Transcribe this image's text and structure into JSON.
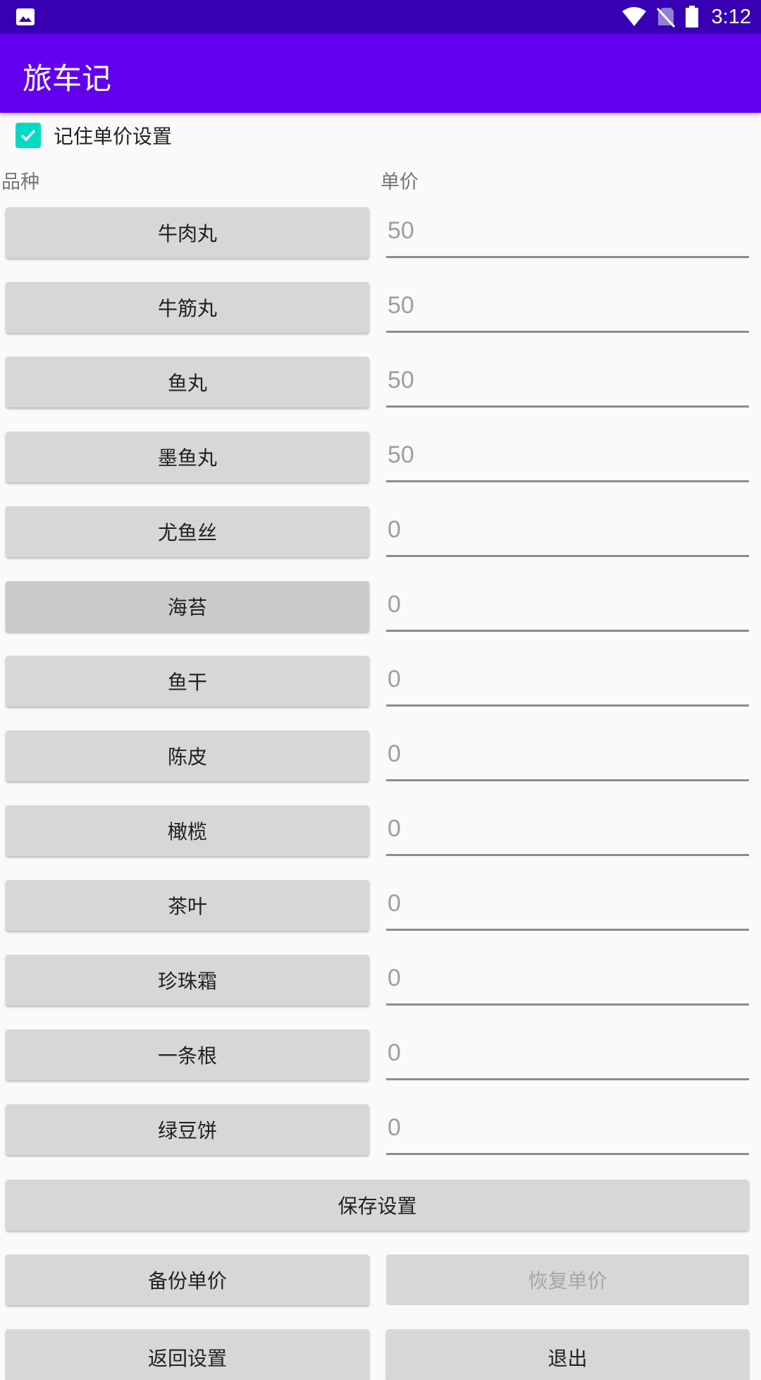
{
  "status_bar": {
    "time": "3:12",
    "icons": [
      "image-notification-icon",
      "wifi-icon",
      "no-sim-icon",
      "battery-icon"
    ]
  },
  "app_bar": {
    "title": "旅车记"
  },
  "remember": {
    "label": "记住单价设置",
    "checked": true,
    "color": "#03dac5"
  },
  "columns": {
    "variety": "品种",
    "price": "单价"
  },
  "items": [
    {
      "name": "牛肉丸",
      "price": "50"
    },
    {
      "name": "牛筋丸",
      "price": "50"
    },
    {
      "name": "鱼丸",
      "price": "50"
    },
    {
      "name": "墨鱼丸",
      "price": "50"
    },
    {
      "name": "尤鱼丝",
      "price": "0"
    },
    {
      "name": "海苔",
      "price": "0"
    },
    {
      "name": "鱼干",
      "price": "0"
    },
    {
      "name": "陈皮",
      "price": "0"
    },
    {
      "name": "橄榄",
      "price": "0"
    },
    {
      "name": "茶叶",
      "price": "0"
    },
    {
      "name": "珍珠霜",
      "price": "0"
    },
    {
      "name": "一条根",
      "price": "0"
    },
    {
      "name": "绿豆饼",
      "price": "0"
    }
  ],
  "actions": {
    "save": "保存设置",
    "backup": "备份单价",
    "restore": "恢复单价",
    "back": "返回设置",
    "exit": "退出"
  },
  "colors": {
    "status_bar": "#3700b3",
    "app_bar": "#6200ee",
    "button": "#d6d7d7"
  }
}
